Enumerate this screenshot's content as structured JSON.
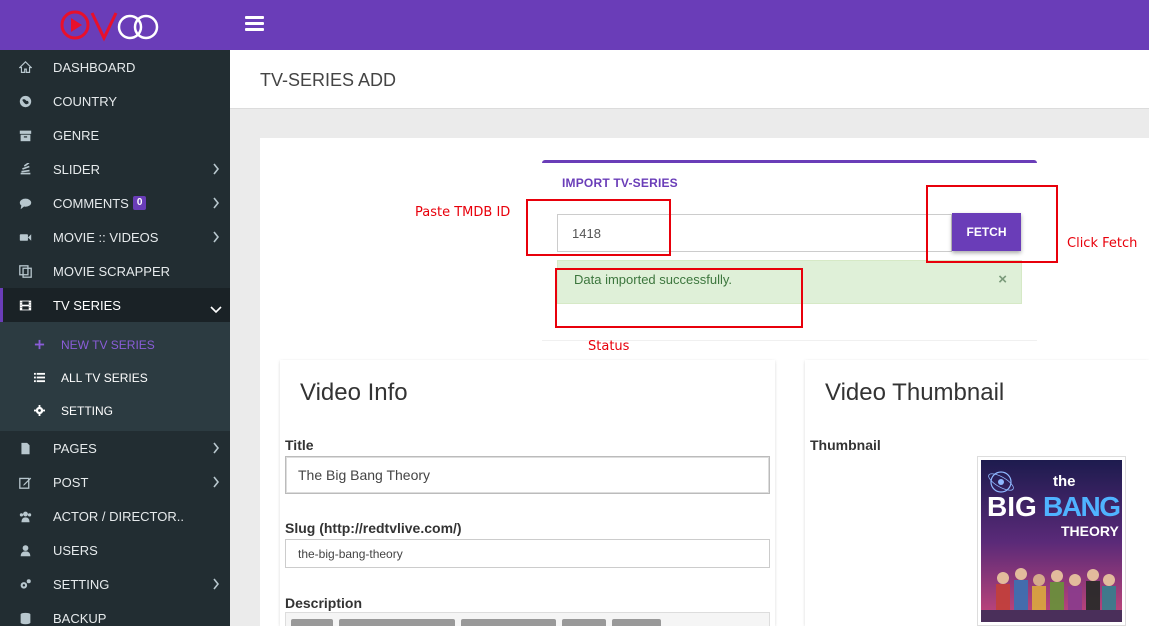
{
  "app": {
    "logo_text": "VOO",
    "brand_color": "#6a3db8",
    "sidebar_bg": "#222d32"
  },
  "sidebar": {
    "items": [
      {
        "label": "DASHBOARD",
        "icon": "home-icon",
        "has_children": false
      },
      {
        "label": "COUNTRY",
        "icon": "globe-icon",
        "has_children": false
      },
      {
        "label": "GENRE",
        "icon": "archive-icon",
        "has_children": false
      },
      {
        "label": "SLIDER",
        "icon": "stack-icon",
        "has_children": true
      },
      {
        "label": "COMMENTS",
        "icon": "comment-icon",
        "has_children": true,
        "badge": "0"
      },
      {
        "label": "MOVIE :: VIDEOS",
        "icon": "video-camera-icon",
        "has_children": true
      },
      {
        "label": "MOVIE SCRAPPER",
        "icon": "copy-icon",
        "has_children": false
      },
      {
        "label": "TV SERIES",
        "icon": "film-icon",
        "has_children": true,
        "expanded": true
      },
      {
        "label": "PAGES",
        "icon": "file-icon",
        "has_children": true
      },
      {
        "label": "POST",
        "icon": "edit-icon",
        "has_children": true
      },
      {
        "label": "ACTOR / DIRECTOR..",
        "icon": "users-icon",
        "has_children": false
      },
      {
        "label": "USERS",
        "icon": "user-icon",
        "has_children": false
      },
      {
        "label": "SETTING",
        "icon": "cogs-icon",
        "has_children": true
      },
      {
        "label": "BACKUP",
        "icon": "database-icon",
        "has_children": false
      }
    ],
    "tv_series_submenu": [
      {
        "label": "NEW TV SERIES",
        "icon": "plus-icon",
        "current": true
      },
      {
        "label": "ALL TV SERIES",
        "icon": "list-icon",
        "current": false
      },
      {
        "label": "SETTING",
        "icon": "gear-icon",
        "current": false
      }
    ]
  },
  "page": {
    "title": "TV-SERIES ADD"
  },
  "import_panel": {
    "title": "IMPORT TV-SERIES",
    "tmdb_id_value": "1418",
    "fetch_label": "FETCH",
    "alert_text": "Data imported successfully.",
    "alert_close": "×"
  },
  "annotations": {
    "paste_label": "Paste TMDB ID",
    "fetch_label": "Click Fetch",
    "status_label": "Status",
    "color": "#e8000b"
  },
  "video_info": {
    "heading": "Video Info",
    "title_label": "Title",
    "title_value": "The Big Bang Theory",
    "slug_label": "Slug (http://redtvlive.com/)",
    "slug_value": "the-big-bang-theory",
    "description_label": "Description"
  },
  "video_thumbnail": {
    "heading": "Video Thumbnail",
    "thumbnail_label": "Thumbnail",
    "poster_line1": "the",
    "poster_line2": "BIG",
    "poster_line3": "BANG",
    "poster_line4": "THEORY"
  }
}
